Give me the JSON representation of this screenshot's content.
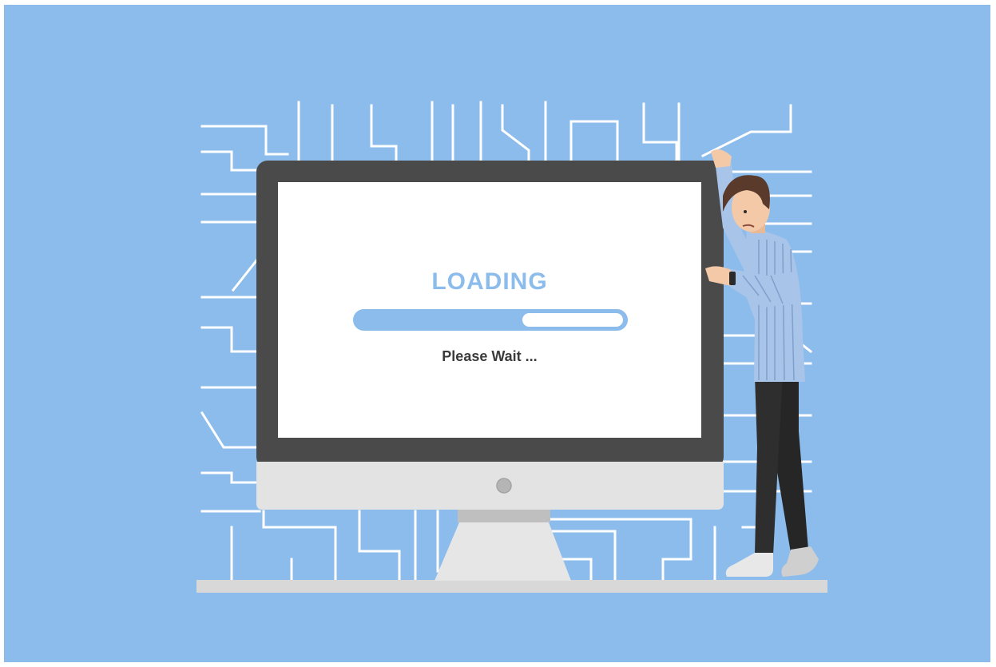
{
  "screen": {
    "title": "LOADING",
    "subtitle": "Please Wait ...",
    "progress_fraction": 0.62
  },
  "colors": {
    "background": "#8bbcec",
    "circuit_lines": "#ffffff",
    "monitor_bezel": "#4a4a4a",
    "monitor_chin": "#e3e3e3",
    "screen": "#ffffff",
    "accent": "#8bbcec",
    "text_dark": "#3b3b3b",
    "shirt": "#a8c4e8",
    "pants": "#2b2b2b",
    "hair": "#5a3a2a",
    "skin": "#f4c9a8"
  },
  "icons": {
    "power_button": "power-button-icon",
    "watch": "wristwatch-icon"
  }
}
